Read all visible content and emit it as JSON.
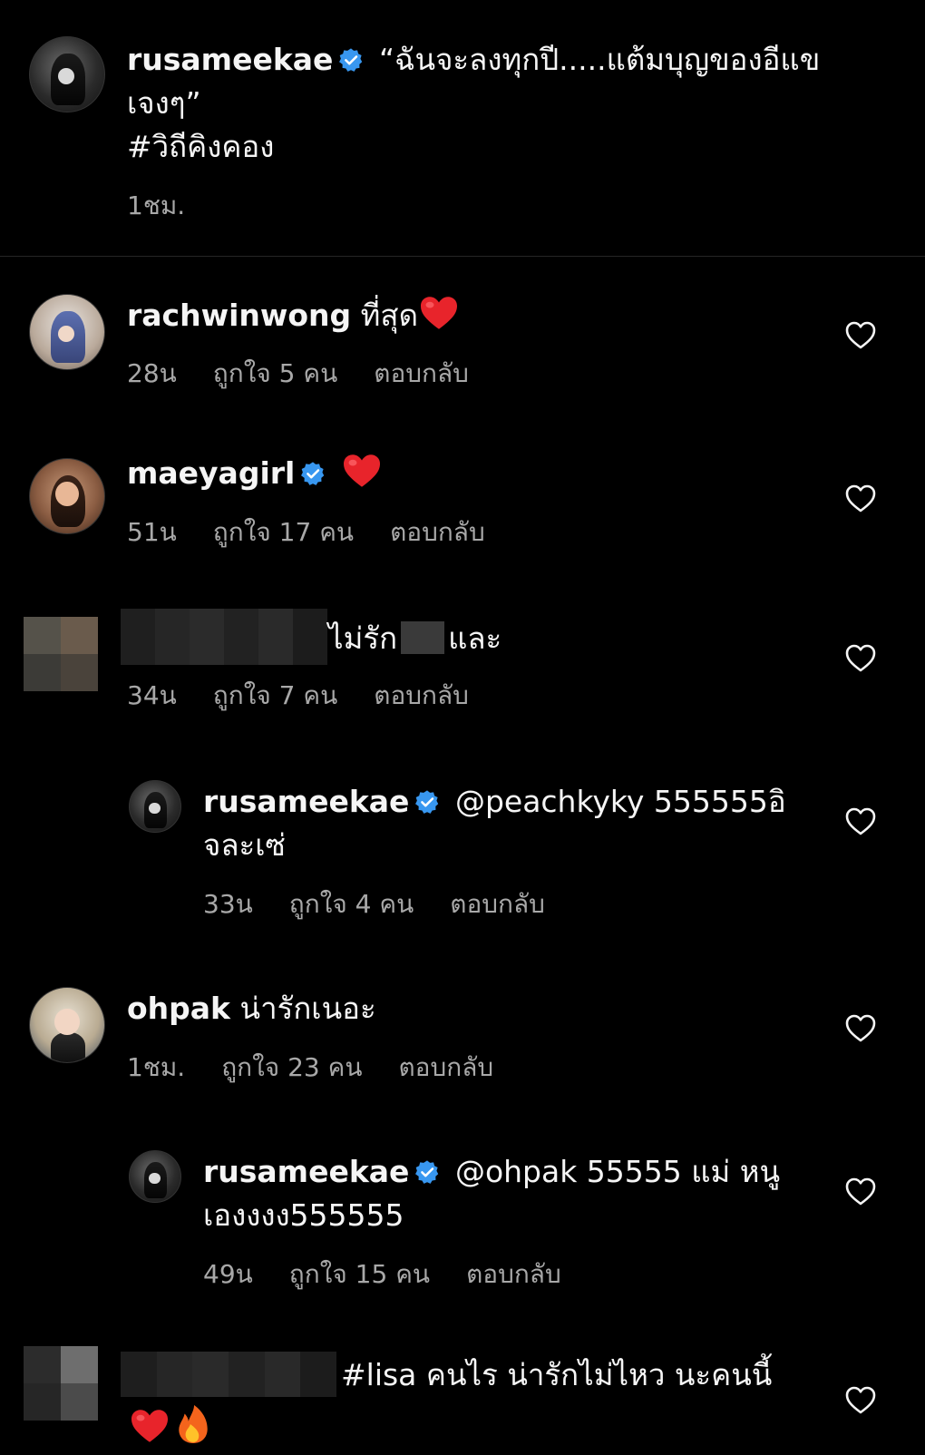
{
  "caption": {
    "username": "rusameekae",
    "text_line1": "“ฉันจะลงทุกปี.....แต้มบุญของอีแข",
    "text_line2": "เจงๆ”",
    "hashtag": "#วิถีคิงคอง",
    "time": "1ชม."
  },
  "comments": [
    {
      "username": "rachwinwong",
      "text": "ที่สุด",
      "time": "28น",
      "likes": "ถูกใจ 5 คน",
      "reply": "ตอบกลับ"
    },
    {
      "username": "maeyagirl",
      "text": "",
      "time": "51น",
      "likes": "ถูกใจ 17 คน",
      "reply": "ตอบกลับ"
    },
    {
      "username": "",
      "text_a": "ไม่รัก",
      "text_b": "และ",
      "time": "34น",
      "likes": "ถูกใจ 7 คน",
      "reply": "ตอบกลับ"
    },
    {
      "username": "rusameekae",
      "text_line1": "@peachkyky 555555อิ",
      "text_line2": "จละเซ่",
      "time": "33น",
      "likes": "ถูกใจ 4 คน",
      "reply": "ตอบกลับ"
    },
    {
      "username": "ohpak",
      "text": "น่ารักเนอะ",
      "time": "1ชม.",
      "likes": "ถูกใจ 23 คน",
      "reply": "ตอบกลับ"
    },
    {
      "username": "rusameekae",
      "text_line1": "@ohpak 55555 แม่ หนู",
      "text_line2": "เองงงง555555",
      "time": "49น",
      "likes": "ถูกใจ 15 คน",
      "reply": "ตอบกลับ"
    },
    {
      "username": "",
      "text": "#lisa  คนไร น่ารักไม่ไหว นะคนนี้"
    }
  ],
  "icons": {
    "verified": "verified-badge-icon",
    "like": "heart-outline-icon",
    "heart_emoji": "red-heart-emoji",
    "fire_emoji": "fire-emoji"
  },
  "colors": {
    "background": "#000000",
    "text": "#f5f5f5",
    "secondary": "#a8a8a8",
    "verified": "#3897f0"
  }
}
